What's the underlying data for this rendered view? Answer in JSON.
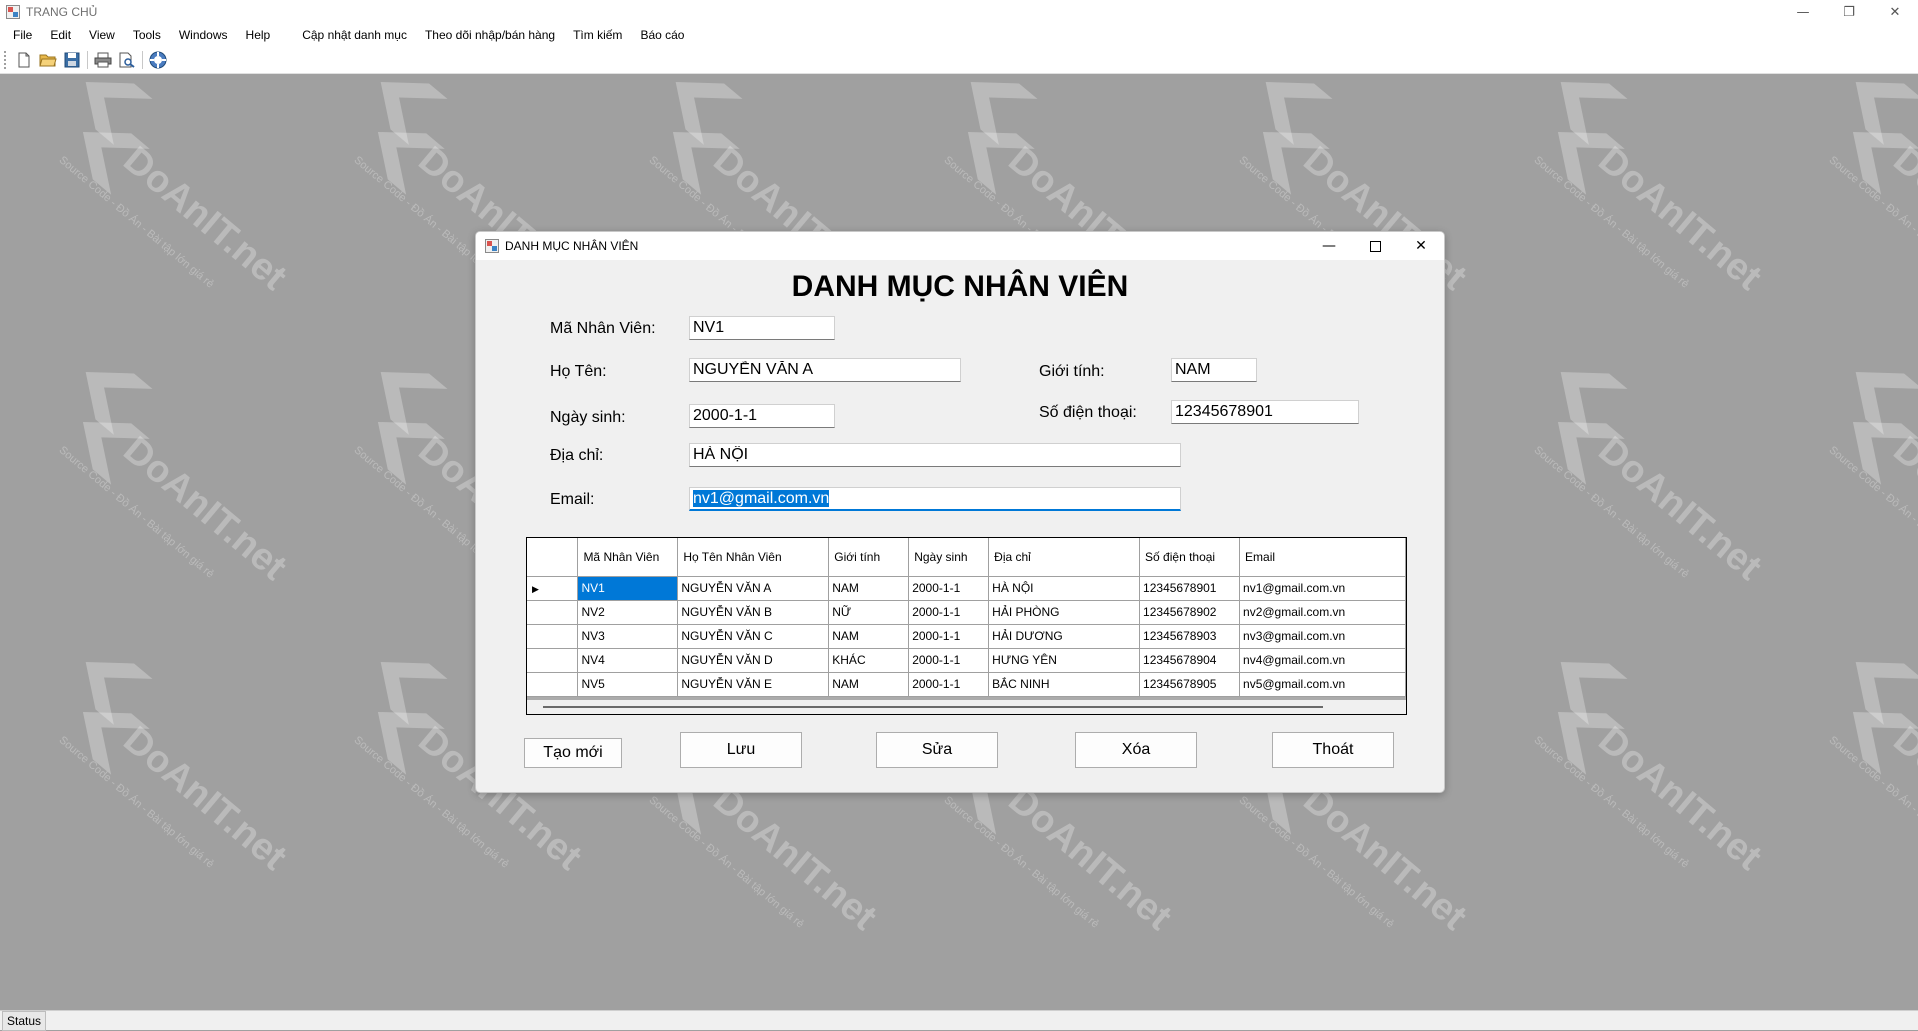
{
  "app": {
    "title": "TRANG CHỦ",
    "window_controls": {
      "minimize": "—",
      "restore": "❐",
      "close": "✕"
    }
  },
  "menu": [
    "File",
    "Edit",
    "View",
    "Tools",
    "Windows",
    "Help",
    "Cập nhật danh mục",
    "Theo dõi nhập/bán hàng",
    "Tìm kiếm",
    "Báo cáo"
  ],
  "toolbar_icons": [
    "new-file-icon",
    "open-folder-icon",
    "save-icon",
    "print-icon",
    "print-preview-icon",
    "help-icon"
  ],
  "dialog": {
    "title": "DANH MỤC NHÂN VIÊN",
    "heading": "DANH MỤC NHÂN VIÊN",
    "labels": {
      "ma_nv": "Mã Nhân Viên:",
      "ho_ten": "Họ Tên:",
      "gioi_tinh": "Giới tính:",
      "ngay_sinh": "Ngày sinh:",
      "sdt": "Số điện thoại:",
      "dia_chi": "Địa chỉ:",
      "email": "Email:"
    },
    "values": {
      "ma_nv": "NV1",
      "ho_ten": "NGUYỄN VĂN A",
      "gioi_tinh": "NAM",
      "ngay_sinh": "2000-1-1",
      "sdt": "12345678901",
      "dia_chi": "HÀ NỘI",
      "email": "nv1@gmail.com.vn"
    },
    "grid": {
      "columns": [
        "Mã Nhân Viên",
        "Họ Tên Nhân Viên",
        "Giới tính",
        "Ngày sinh",
        "Địa chỉ",
        "Số điện thoại",
        "Email"
      ],
      "rows": [
        [
          "NV1",
          "NGUYỄN VĂN A",
          "NAM",
          "2000-1-1",
          "HÀ NỘI",
          "12345678901",
          "nv1@gmail.com.vn"
        ],
        [
          "NV2",
          "NGUYỄN VĂN B",
          "NỮ",
          "2000-1-1",
          "HẢI PHÒNG",
          "12345678902",
          "nv2@gmail.com.vn"
        ],
        [
          "NV3",
          "NGUYỄN VĂN C",
          "NAM",
          "2000-1-1",
          "HẢI DƯƠNG",
          "12345678903",
          "nv3@gmail.com.vn"
        ],
        [
          "NV4",
          "NGUYỄN VĂN D",
          "KHÁC",
          "2000-1-1",
          "HƯNG YÊN",
          "12345678904",
          "nv4@gmail.com.vn"
        ],
        [
          "NV5",
          "NGUYỄN VĂN E",
          "NAM",
          "2000-1-1",
          "BẮC NINH",
          "12345678905",
          "nv5@gmail.com.vn"
        ]
      ]
    },
    "buttons": {
      "tao_moi": "Tạo mới",
      "luu": "Lưu",
      "sua": "Sửa",
      "xoa": "Xóa",
      "thoat": "Thoát"
    }
  },
  "status": "Status",
  "watermark": {
    "brand": "DoAnIT.net",
    "tagline": "Source Code - Đồ Án - Bài tập lớn giá rẻ"
  },
  "colors": {
    "background": "#a0a0a0",
    "selection": "#0078d7",
    "window": "#f0f0f0"
  }
}
